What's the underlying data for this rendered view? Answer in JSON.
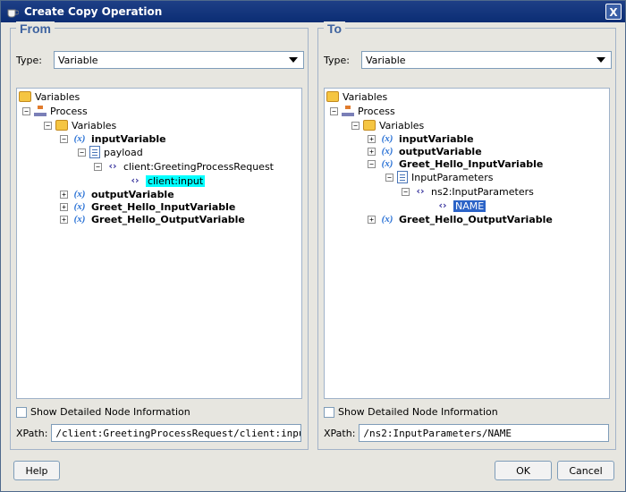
{
  "window": {
    "title": "Create Copy Operation",
    "close_glyph": "X"
  },
  "from": {
    "legend": "From",
    "type_label": "Type:",
    "type_value": "Variable",
    "tree": [
      {
        "label": "Variables"
      },
      {
        "label": "Process"
      },
      {
        "label": "Variables"
      },
      {
        "label": "inputVariable",
        "bold": true
      },
      {
        "label": "payload"
      },
      {
        "label": "client:GreetingProcessRequest"
      },
      {
        "label": "client:input",
        "selected": true
      },
      {
        "label": "outputVariable",
        "bold": true
      },
      {
        "label": "Greet_Hello_InputVariable",
        "bold": true
      },
      {
        "label": "Greet_Hello_OutputVariable",
        "bold": true
      }
    ],
    "show_detail_label": "Show Detailed Node Information",
    "xpath_label": "XPath:",
    "xpath_value": "/client:GreetingProcessRequest/client:input"
  },
  "to": {
    "legend": "To",
    "type_label": "Type:",
    "type_value": "Variable",
    "tree": [
      {
        "label": "Variables"
      },
      {
        "label": "Process"
      },
      {
        "label": "Variables"
      },
      {
        "label": "inputVariable",
        "bold": true
      },
      {
        "label": "outputVariable",
        "bold": true
      },
      {
        "label": "Greet_Hello_InputVariable",
        "bold": true
      },
      {
        "label": "InputParameters"
      },
      {
        "label": "ns2:InputParameters"
      },
      {
        "label": "NAME",
        "selected": true
      },
      {
        "label": "Greet_Hello_OutputVariable",
        "bold": true
      }
    ],
    "show_detail_label": "Show Detailed Node Information",
    "xpath_label": "XPath:",
    "xpath_value": "/ns2:InputParameters/NAME"
  },
  "buttons": {
    "help": "Help",
    "ok": "OK",
    "cancel": "Cancel"
  },
  "icons": {
    "folder": "folder-icon",
    "process": "process-icon",
    "variable": "variable-icon",
    "document": "document-icon",
    "element": "element-icon"
  },
  "colors": {
    "title_bar": "#0b2d74",
    "legend": "#3e63a0",
    "selection_cyan": "#00ffff",
    "selection_blue": "#2b63c7"
  }
}
